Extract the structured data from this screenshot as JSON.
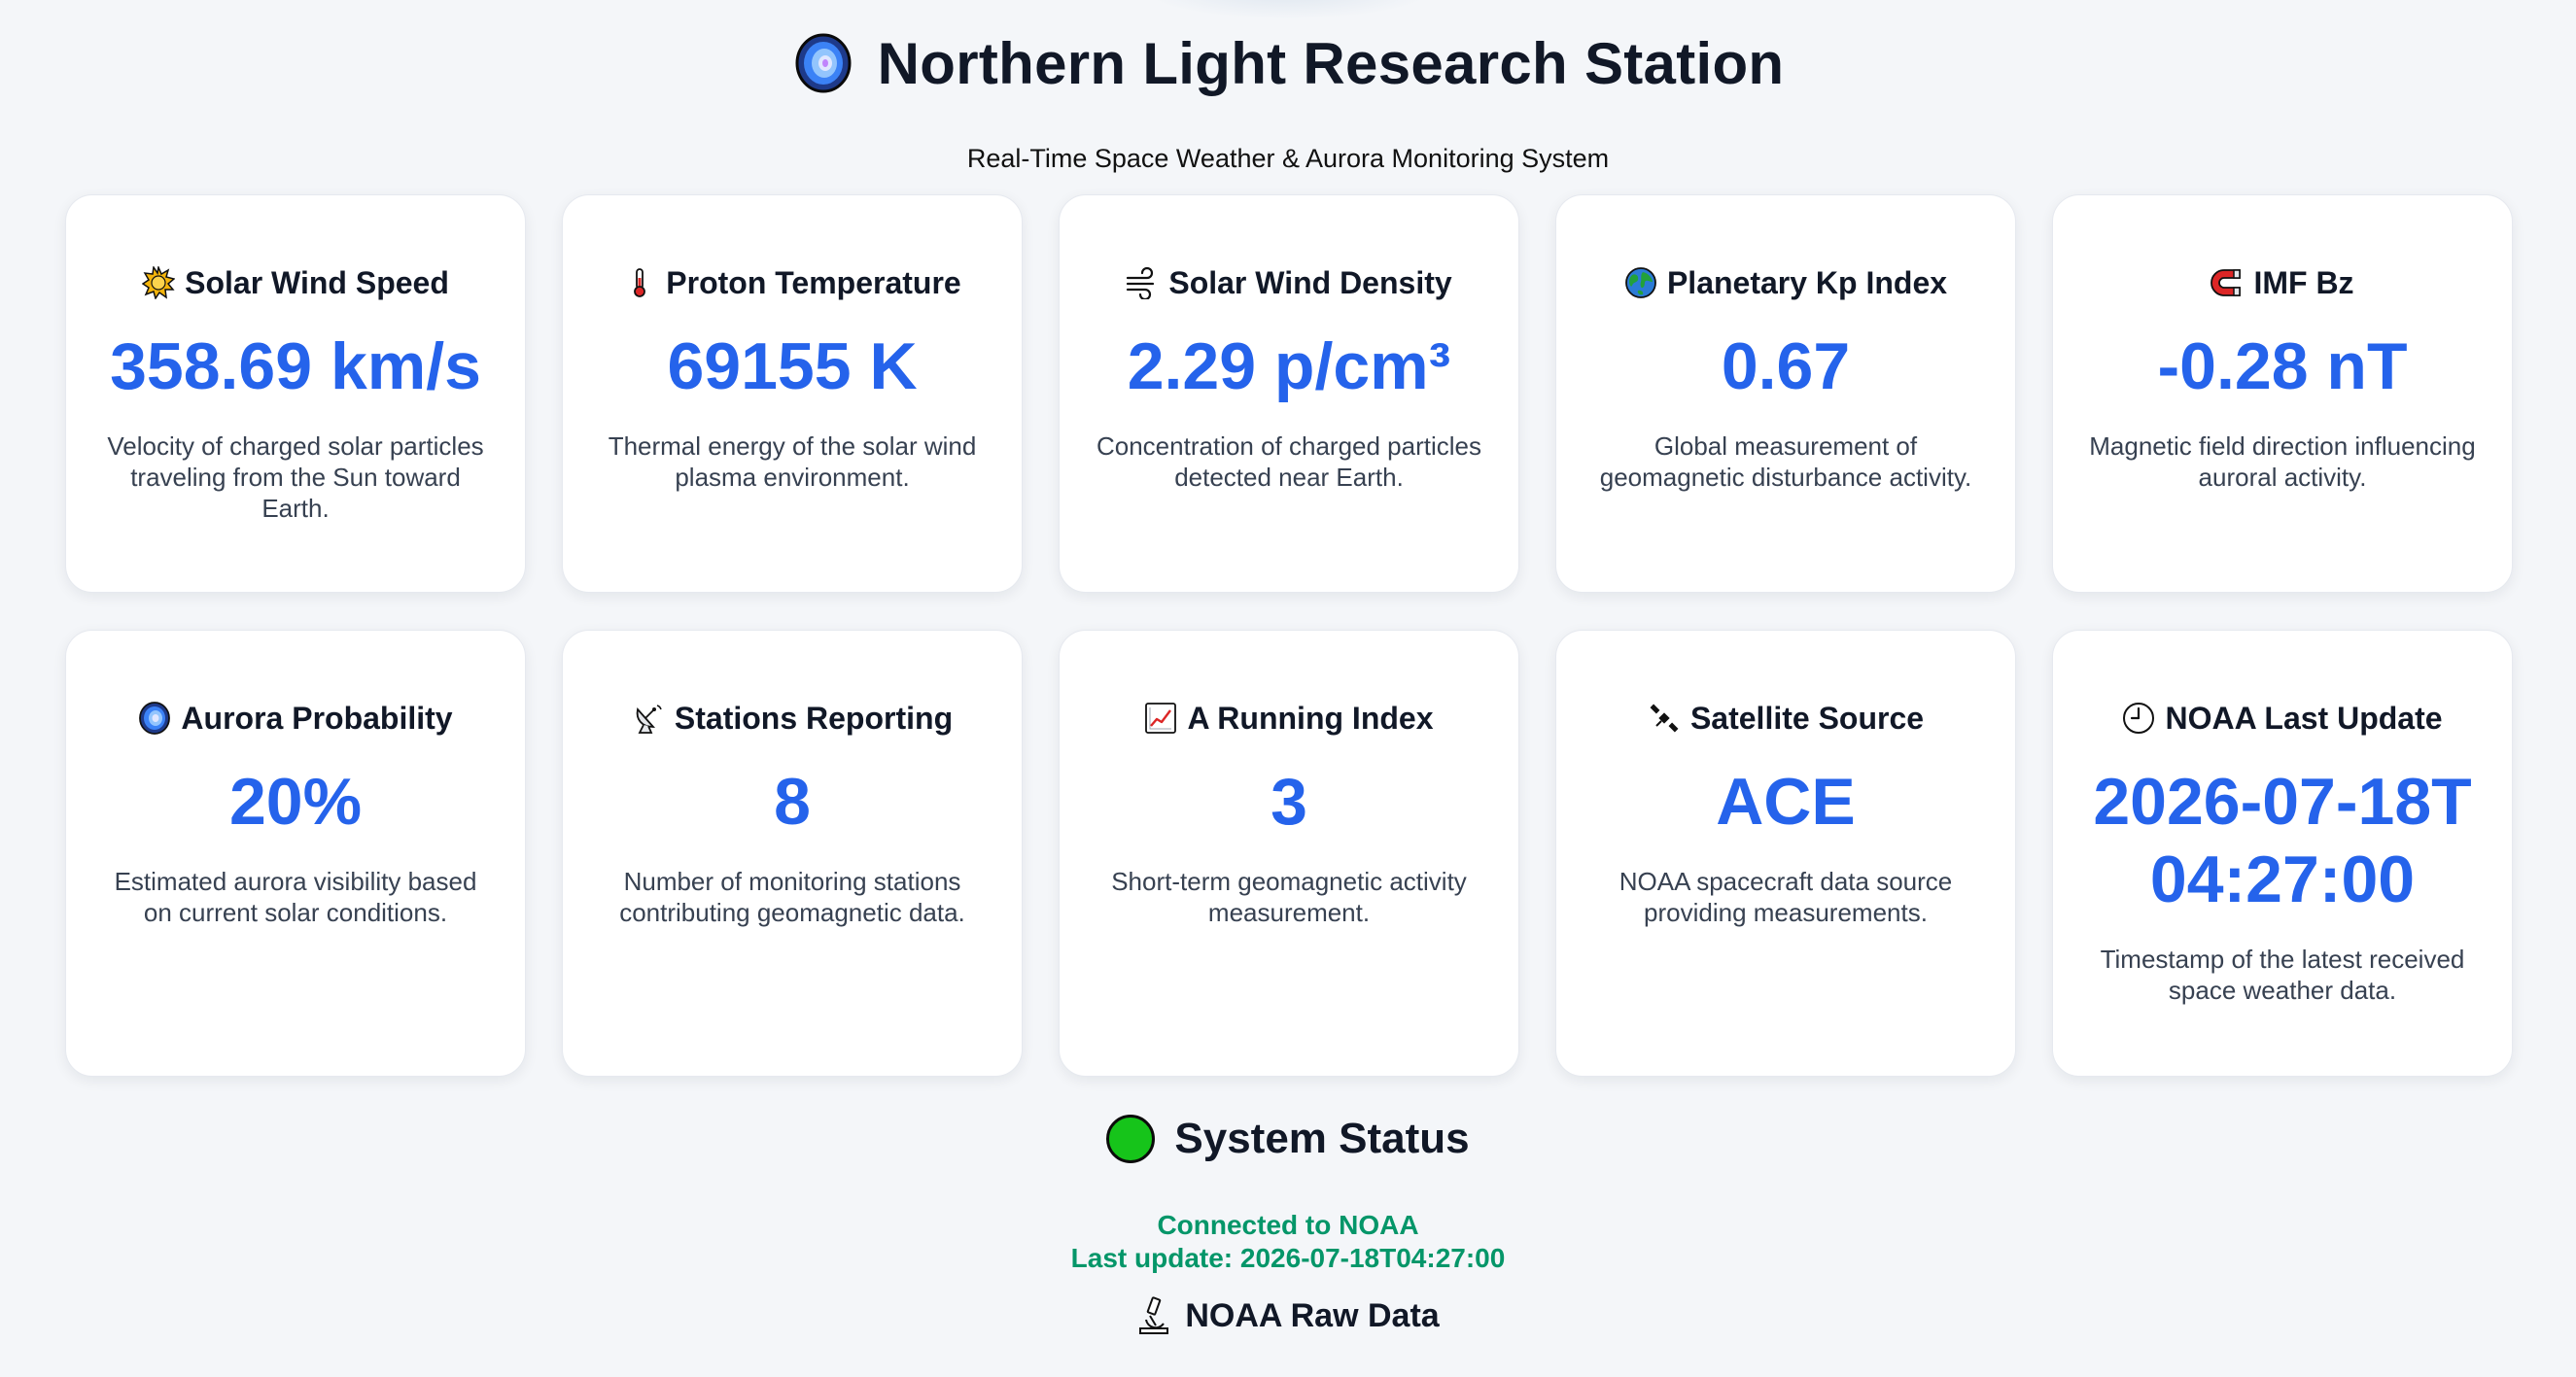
{
  "header": {
    "title": "Northern Light Research Station",
    "subtitle": "Real-Time Space Weather & Aurora Monitoring System",
    "icon": "aurora-icon"
  },
  "cards": [
    {
      "title": "Solar Wind Speed",
      "value": "358.69 km/s",
      "desc": "Velocity of charged solar particles traveling from the Sun toward Earth.",
      "icon": "sun-icon"
    },
    {
      "title": "Proton Temperature",
      "value": "69155 K",
      "desc": "Thermal energy of the solar wind plasma environment.",
      "icon": "thermometer-icon"
    },
    {
      "title": "Solar Wind Density",
      "value": "2.29 p/cm³",
      "desc": "Concentration of charged particles detected near Earth.",
      "icon": "wind-icon"
    },
    {
      "title": "Planetary Kp Index",
      "value": "0.67",
      "desc": "Global measurement of geomagnetic disturbance activity.",
      "icon": "globe-icon"
    },
    {
      "title": "IMF Bz",
      "value": "-0.28 nT",
      "desc": "Magnetic field direction influencing auroral activity.",
      "icon": "magnet-icon"
    },
    {
      "title": "Aurora Probability",
      "value": "20%",
      "desc": "Estimated aurora visibility based on current solar conditions.",
      "icon": "aurora-icon"
    },
    {
      "title": "Stations Reporting",
      "value": "8",
      "desc": "Number of monitoring stations contributing geomagnetic data.",
      "icon": "satellite-dish-icon"
    },
    {
      "title": "A Running Index",
      "value": "3",
      "desc": "Short-term geomagnetic activity measurement.",
      "icon": "chart-up-icon"
    },
    {
      "title": "Satellite Source",
      "value": "ACE",
      "desc": "NOAA spacecraft data source providing measurements.",
      "icon": "satellite-icon"
    },
    {
      "title": "NOAA Last Update",
      "value": "2026-07-18T04:27:00",
      "desc": "Timestamp of the latest received space weather data.",
      "icon": "clock-icon"
    }
  ],
  "status": {
    "title": "System Status",
    "connected": "Connected to NOAA",
    "last_update": "Last update: 2026-07-18T04:27:00",
    "dot_color": "#16c41a",
    "text_color": "#059669"
  },
  "raw": {
    "title": "NOAA Raw Data",
    "icon": "microscope-icon"
  },
  "colors": {
    "accent": "#2563eb",
    "background": "#f4f6f9"
  }
}
